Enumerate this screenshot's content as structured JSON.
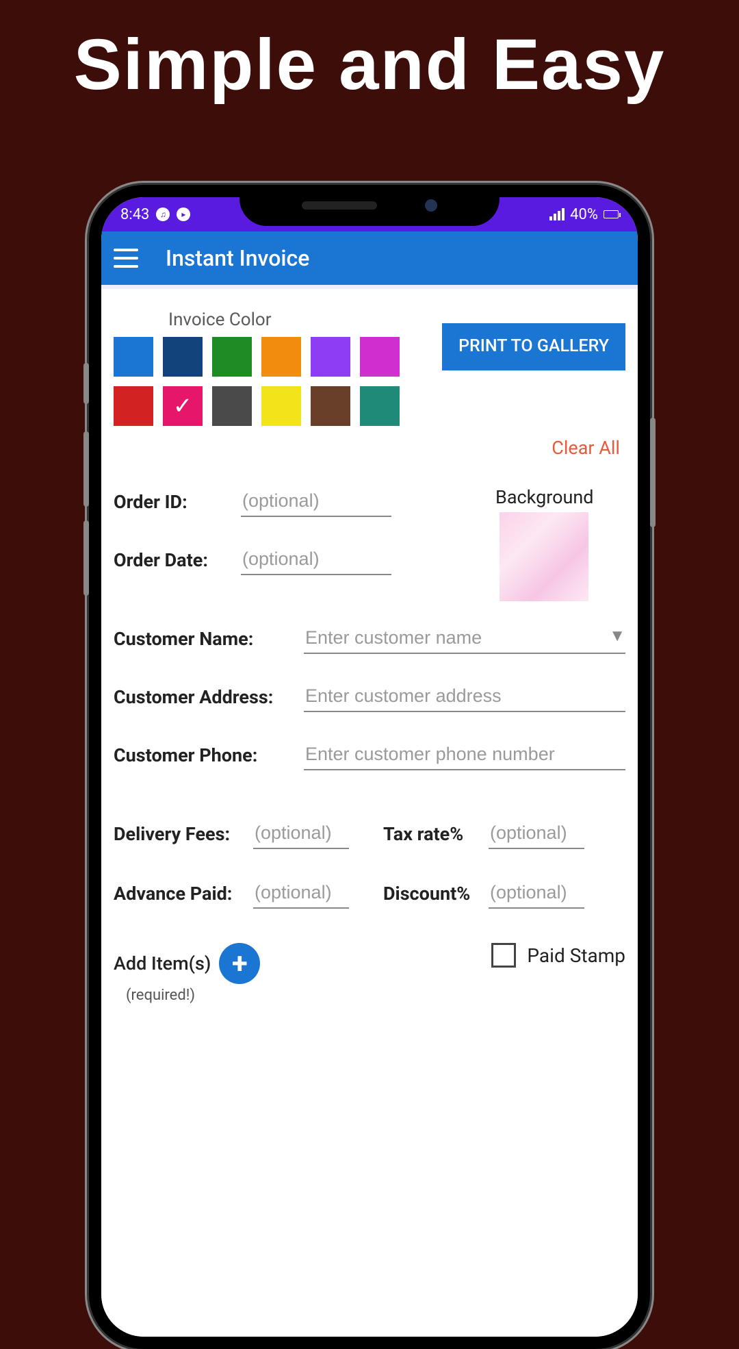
{
  "headline": "Simple and Easy",
  "statusBar": {
    "time": "8:43",
    "battery": "40%"
  },
  "appBar": {
    "title": "Instant Invoice"
  },
  "colorSection": {
    "label": "Invoice Color",
    "colors": [
      {
        "hex": "#1a76d2",
        "selected": false
      },
      {
        "hex": "#12437a",
        "selected": false
      },
      {
        "hex": "#1f8b24",
        "selected": false
      },
      {
        "hex": "#f28c0f",
        "selected": false
      },
      {
        "hex": "#8e3df5",
        "selected": false
      },
      {
        "hex": "#cf2fcf",
        "selected": false
      },
      {
        "hex": "#d32222",
        "selected": false
      },
      {
        "hex": "#e6176b",
        "selected": true
      },
      {
        "hex": "#4a4a4a",
        "selected": false
      },
      {
        "hex": "#f3e31a",
        "selected": false
      },
      {
        "hex": "#6a3f2a",
        "selected": false
      },
      {
        "hex": "#1f8a78",
        "selected": false
      }
    ]
  },
  "buttons": {
    "printToGallery": "PRINT TO GALLERY",
    "clearAll": "Clear All"
  },
  "background": {
    "label": "Background"
  },
  "fields": {
    "orderId": {
      "label": "Order ID:",
      "placeholder": "(optional)"
    },
    "orderDate": {
      "label": "Order Date:",
      "placeholder": "(optional)"
    },
    "customerName": {
      "label": "Customer Name:",
      "placeholder": "Enter customer name"
    },
    "customerAddress": {
      "label": "Customer Address:",
      "placeholder": "Enter customer address"
    },
    "customerPhone": {
      "label": "Customer Phone:",
      "placeholder": "Enter customer phone number"
    },
    "deliveryFees": {
      "label": "Delivery Fees:",
      "placeholder": "(optional)"
    },
    "taxRate": {
      "label": "Tax rate%",
      "placeholder": "(optional)"
    },
    "advancePaid": {
      "label": "Advance Paid:",
      "placeholder": "(optional)"
    },
    "discount": {
      "label": "Discount%",
      "placeholder": "(optional)"
    }
  },
  "addItems": {
    "label": "Add Item(s)",
    "required": "(required!)"
  },
  "paidStamp": {
    "label": "Paid Stamp",
    "checked": false
  }
}
